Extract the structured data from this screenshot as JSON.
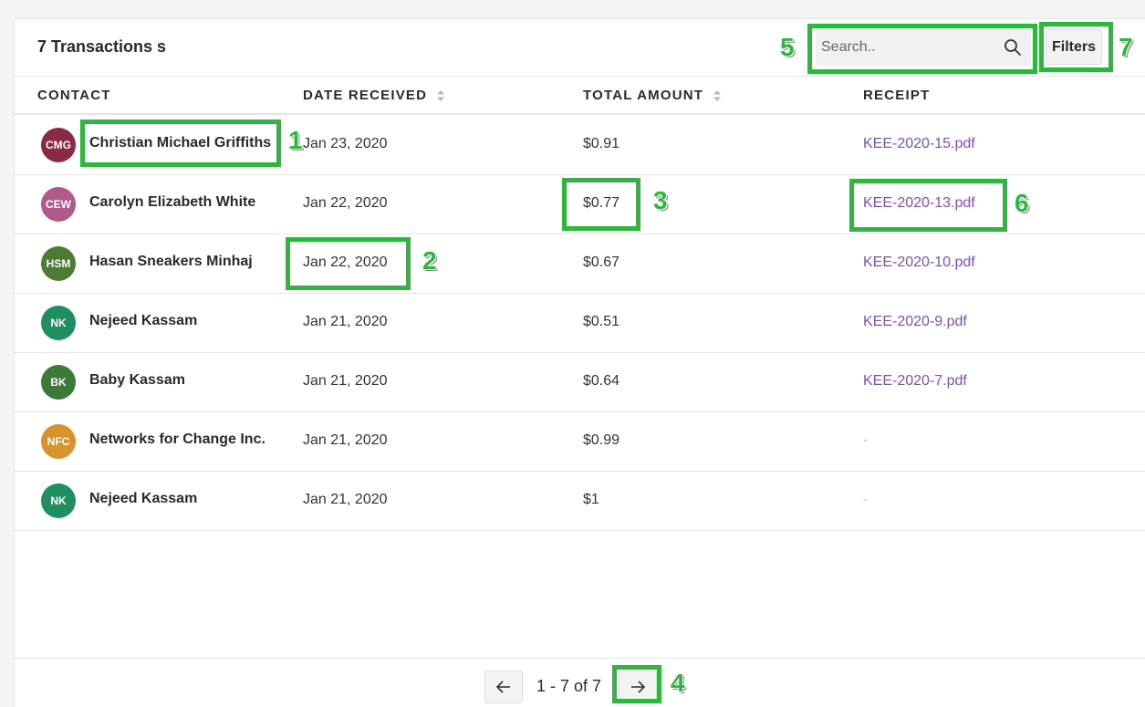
{
  "header": {
    "title": "7 Transactions s",
    "search_placeholder": "Search..",
    "filters_label": "Filters"
  },
  "table": {
    "columns": [
      "CONTACT",
      "DATE RECEIVED",
      "TOTAL AMOUNT",
      "RECEIPT"
    ],
    "rows": [
      {
        "initials": "CMG",
        "avatar_color": "#8b2b43",
        "contact": "Christian Michael Griffiths",
        "date": "Jan 23, 2020",
        "amount": "$0.91",
        "receipt": "KEE-2020-15.pdf"
      },
      {
        "initials": "CEW",
        "avatar_color": "#b05a8c",
        "contact": "Carolyn Elizabeth White",
        "date": "Jan 22, 2020",
        "amount": "$0.77",
        "receipt": "KEE-2020-13.pdf"
      },
      {
        "initials": "HSM",
        "avatar_color": "#4e7a33",
        "contact": "Hasan Sneakers Minhaj",
        "date": "Jan 22, 2020",
        "amount": "$0.67",
        "receipt": "KEE-2020-10.pdf"
      },
      {
        "initials": "NK",
        "avatar_color": "#1f8f62",
        "contact": "Nejeed Kassam",
        "date": "Jan 21, 2020",
        "amount": "$0.51",
        "receipt": "KEE-2020-9.pdf"
      },
      {
        "initials": "BK",
        "avatar_color": "#3d7a3a",
        "contact": "Baby Kassam",
        "date": "Jan 21, 2020",
        "amount": "$0.64",
        "receipt": "KEE-2020-7.pdf"
      },
      {
        "initials": "NFC",
        "avatar_color": "#d8932f",
        "contact": "Networks for Change Inc.",
        "date": "Jan 21, 2020",
        "amount": "$0.99",
        "receipt": "-"
      },
      {
        "initials": "NK",
        "avatar_color": "#1f8f62",
        "contact": "Nejeed Kassam",
        "date": "Jan 21, 2020",
        "amount": "$1",
        "receipt": "-"
      }
    ]
  },
  "pagination": {
    "range_text": "1 - 7 of 7"
  },
  "annotations": {
    "marker_color": "#2db83d",
    "labels": [
      "1",
      "2",
      "3",
      "4",
      "5",
      "6",
      "7"
    ]
  },
  "icons": {
    "search": "search-icon",
    "sort": "sort-icon",
    "prev": "arrow-left-icon",
    "next": "arrow-right-icon"
  }
}
